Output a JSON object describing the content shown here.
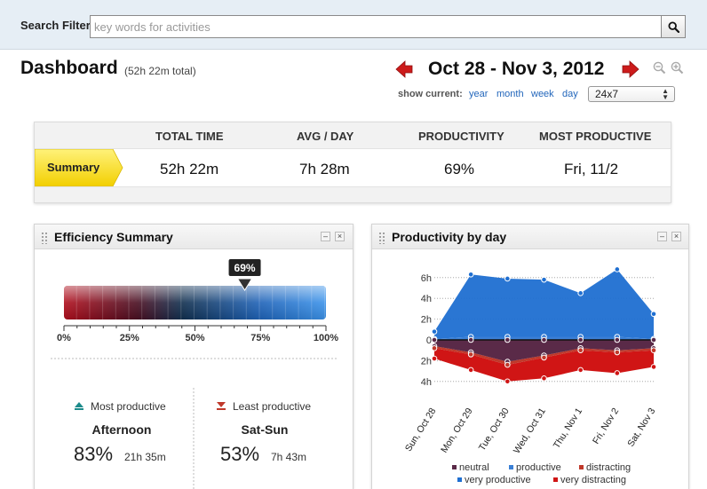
{
  "search": {
    "label": "Search Filter",
    "placeholder": "key words for activities"
  },
  "header": {
    "title": "Dashboard",
    "total": "(52h 22m total)",
    "date_range": "Oct 28 - Nov 3, 2012",
    "show_current_label": "show current:",
    "links": [
      "year",
      "month",
      "week",
      "day"
    ],
    "range_select": "24x7"
  },
  "summary": {
    "headers": [
      "TOTAL TIME",
      "AVG / DAY",
      "PRODUCTIVITY",
      "MOST PRODUCTIVE"
    ],
    "row_label": "Summary",
    "values": [
      "52h 22m",
      "7h 28m",
      "69%",
      "Fri, 11/2"
    ]
  },
  "efficiency": {
    "title": "Efficiency Summary",
    "marker_label": "69%",
    "marker_value": 0.69,
    "scale": [
      "0%",
      "25%",
      "50%",
      "75%",
      "100%"
    ],
    "most": {
      "label": "Most productive",
      "period": "Afternoon",
      "percent": "83%",
      "time": "21h 35m"
    },
    "least": {
      "label": "Least productive",
      "period": "Sat-Sun",
      "percent": "53%",
      "time": "7h 43m"
    }
  },
  "productivity": {
    "title": "Productivity by day",
    "legend": [
      {
        "label": "neutral",
        "color": "#5a2a48"
      },
      {
        "label": "productive",
        "color": "#3a7fd5"
      },
      {
        "label": "distracting",
        "color": "#c0392b"
      },
      {
        "label": "very productive",
        "color": "#1f6fd1"
      },
      {
        "label": "very distracting",
        "color": "#d01515"
      }
    ]
  },
  "chart_data": {
    "type": "area",
    "title": "Productivity by day",
    "categories": [
      "Sun, Oct 28",
      "Mon, Oct 29",
      "Tue, Oct 30",
      "Wed, Oct 31",
      "Thu, Nov 1",
      "Fri, Nov 2",
      "Sat, Nov 3"
    ],
    "y_ticks": [
      "6h",
      "4h",
      "2h",
      "0",
      "2h",
      "4h"
    ],
    "ylim": [
      -4,
      7
    ],
    "series": [
      {
        "name": "very productive",
        "values": [
          0.8,
          6.3,
          5.9,
          5.8,
          4.5,
          6.8,
          2.5
        ]
      },
      {
        "name": "productive",
        "values": [
          0.1,
          0.3,
          0.3,
          0.3,
          0.3,
          0.3,
          0.1
        ]
      },
      {
        "name": "neutral",
        "values": [
          -0.6,
          -1.2,
          -2.1,
          -1.5,
          -0.8,
          -1.0,
          -0.8
        ]
      },
      {
        "name": "distracting",
        "values": [
          -0.2,
          -0.2,
          -0.3,
          -0.2,
          -0.2,
          -0.2,
          -0.2
        ]
      },
      {
        "name": "very distracting",
        "values": [
          -1.8,
          -2.9,
          -4.0,
          -3.7,
          -2.9,
          -3.2,
          -2.6
        ]
      }
    ]
  }
}
